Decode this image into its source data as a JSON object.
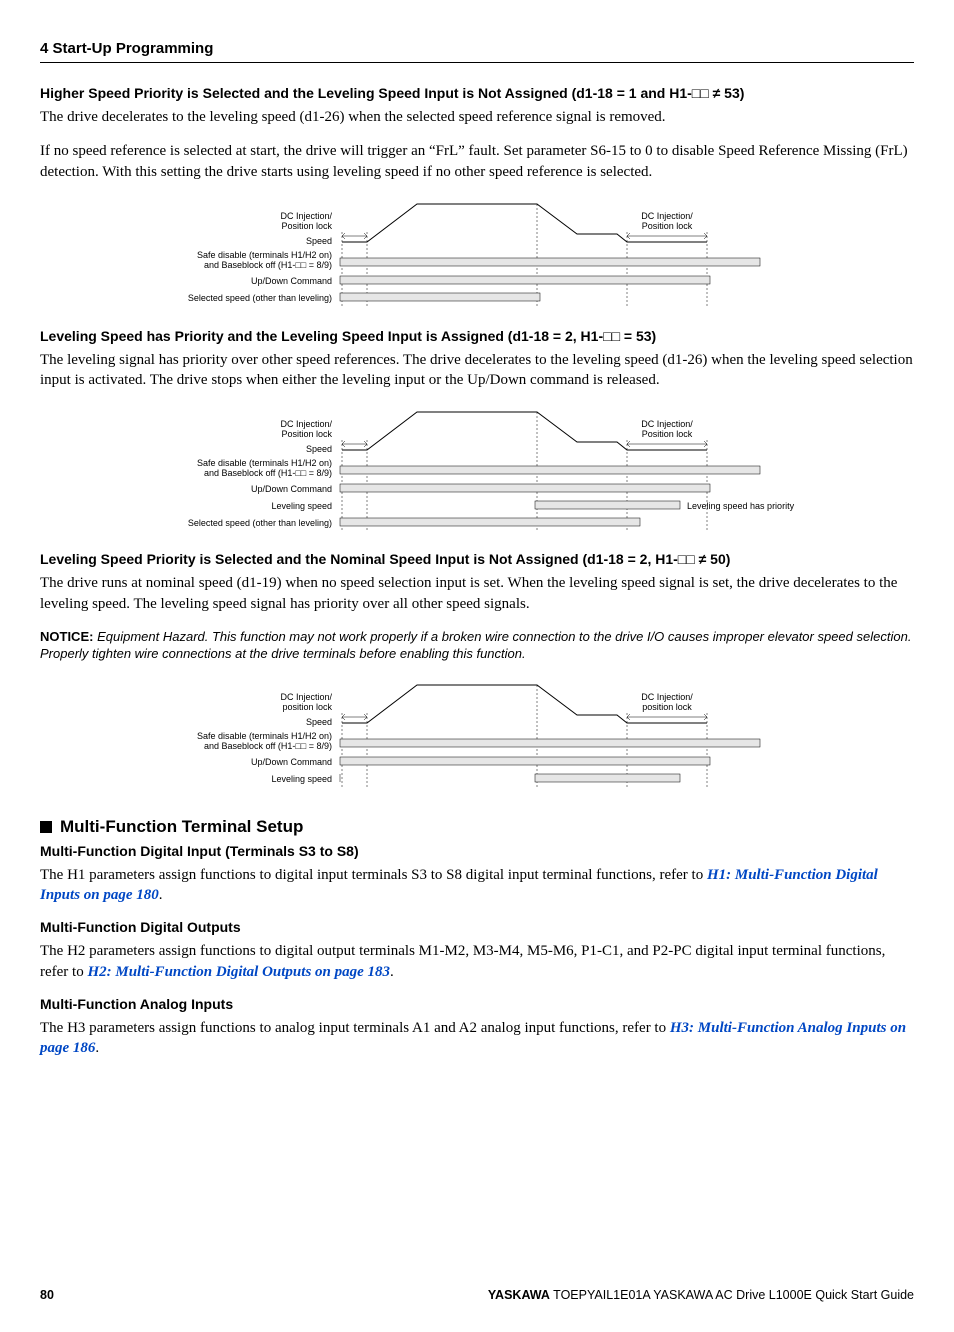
{
  "chapter": "4  Start-Up Programming",
  "s1": {
    "title": "Higher Speed Priority is Selected and the Leveling Speed Input is Not Assigned (d1-18 = 1 and H1-□□ ≠ 53)",
    "p1": "The drive decelerates to the leveling speed (d1-26) when the selected speed reference signal is removed.",
    "p2": "If no speed reference is selected at start, the drive will trigger an “FrL” fault. Set parameter S6-15 to 0 to disable Speed Reference Missing (FrL) detection. With this setting the drive starts using leveling speed if no other speed reference is selected."
  },
  "s2": {
    "title": "Leveling Speed has Priority and the Leveling Speed Input is Assigned (d1-18 = 2, H1-□□ = 53)",
    "p1": "The leveling signal has priority over other speed references. The drive decelerates to the leveling speed (d1-26) when the leveling speed selection input is activated. The drive stops when either the leveling input or the Up/Down command is released."
  },
  "s3": {
    "title": "Leveling Speed Priority is Selected and the Nominal Speed Input is Not Assigned (d1-18 = 2, H1-□□ ≠ 50)",
    "p1": "The drive runs at nominal speed (d1-19) when no speed selection input is set. When the leveling speed signal is set, the drive decelerates to the leveling speed. The leveling speed signal has priority over all other speed signals.",
    "notice_label": "NOTICE:",
    "notice": "Equipment Hazard. This function may not work properly if a broken wire connection to the drive I/O causes improper elevator speed selection. Properly tighten wire connections at the drive terminals before enabling this function."
  },
  "mf": {
    "head": "Multi-Function Terminal Setup",
    "h1": "Multi-Function Digital Input (Terminals S3 to S8)",
    "p1a": "The H1 parameters assign functions to digital input terminals S3 to S8 digital input terminal functions, refer to ",
    "l1": "H1: Multi-Function Digital Inputs on page 180",
    "p1b": ".",
    "h2": "Multi-Function Digital Outputs",
    "p2a": "The H2 parameters assign functions to digital output terminals M1-M2, M3-M4, M5-M6, P1-C1, and P2-PC digital input terminal functions, refer to ",
    "l2": "H2: Multi-Function Digital Outputs on page 183",
    "p2b": ".",
    "h3": "Multi-Function Analog Inputs",
    "p3a": "The H3 parameters assign functions to analog input terminals A1 and A2 analog input functions, refer to ",
    "l3": "H3: Multi-Function Analog Inputs on page 186",
    "p3b": "."
  },
  "dia": {
    "dc_inj_pl": "DC Injection/\nPosition lock",
    "dc_inj_pl_l": "DC Injection/\nposition lock",
    "speed": "Speed",
    "safe1": "Safe disable (terminals H1/H2 on)",
    "safe2": "and Baseblock off (H1-□□ = 8/9)",
    "updown": "Up/Down Command",
    "sel_speed": "Selected speed (other than leveling)",
    "lev_speed": "Leveling speed",
    "lev_prio": "Leveling speed has priority"
  },
  "footer": {
    "page": "80",
    "brand": "YASKAWA",
    "rest": " TOEPYAIL1E01A YASKAWA AC Drive L1000E Quick Start Guide"
  }
}
